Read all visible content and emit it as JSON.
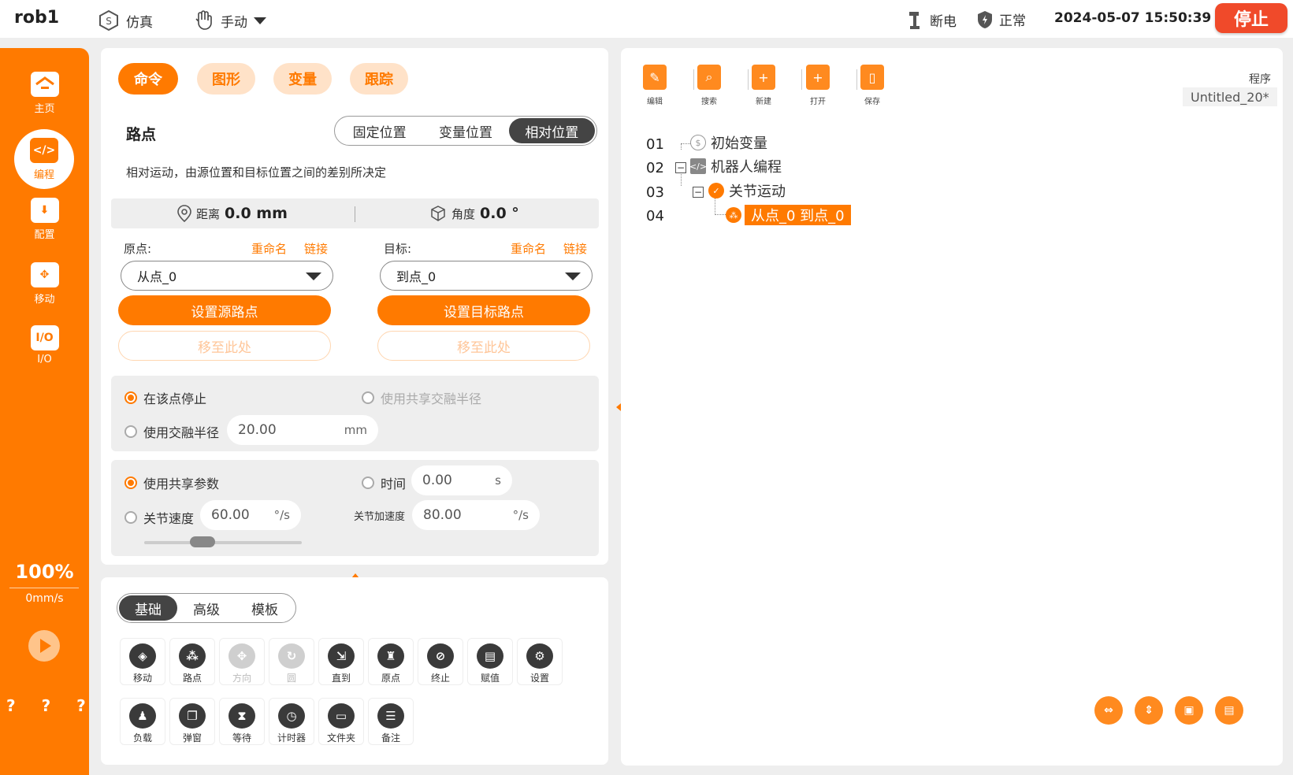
{
  "topbar": {
    "robot_name": "rob1",
    "sim_label": "仿真",
    "mode_label": "手动",
    "power_label": "断电",
    "safety_label": "正常",
    "datetime": "2024-05-07 15:50:39",
    "stop_label": "停止"
  },
  "sidebar": {
    "items": [
      {
        "label": "主页"
      },
      {
        "label": "编程"
      },
      {
        "label": "配置"
      },
      {
        "label": "移动"
      },
      {
        "label": "I/O",
        "icon_text": "I/O"
      }
    ],
    "speed_percent": "100%",
    "speed_value": "0mm/s",
    "help_marks": "? ? ? ?"
  },
  "tabs": [
    "命令",
    "图形",
    "变量",
    "跟踪"
  ],
  "waypoint": {
    "title": "路点",
    "modes": [
      "固定位置",
      "变量位置",
      "相对位置"
    ],
    "description": "相对运动，由源位置和目标位置之间的差别所决定",
    "distance_label": "距离",
    "distance_value": "0.0 mm",
    "angle_label": "角度",
    "angle_value": "0.0 °",
    "source_label": "原点:",
    "target_label": "目标:",
    "rename_label": "重命名",
    "link_label": "链接",
    "source_value": "从点_0",
    "target_value": "到点_0",
    "set_source_label": "设置源路点",
    "set_target_label": "设置目标路点",
    "move_here_label": "移至此处"
  },
  "blend": {
    "stop_label": "在该点停止",
    "shared_blend_label": "使用共享交融半径",
    "blend_label": "使用交融半径",
    "blend_value": "20.00",
    "blend_unit": "mm"
  },
  "params": {
    "shared_label": "使用共享参数",
    "time_label": "时间",
    "time_value": "0.00",
    "time_unit": "s",
    "joint_speed_label": "关节速度",
    "joint_speed_value": "60.00",
    "joint_speed_unit": "°/s",
    "joint_accel_label": "关节加速度",
    "joint_accel_value": "80.00",
    "joint_accel_unit": "°/s"
  },
  "library": {
    "tabs": [
      "基础",
      "高级",
      "模板"
    ],
    "row1": [
      {
        "label": "移动",
        "icon": "move-icon",
        "glyph": "◈"
      },
      {
        "label": "路点",
        "icon": "waypoint-icon",
        "glyph": "⁂"
      },
      {
        "label": "方向",
        "icon": "direction-icon",
        "glyph": "✥"
      },
      {
        "label": "圆",
        "icon": "circle-icon",
        "glyph": "↻"
      },
      {
        "label": "直到",
        "icon": "until-icon",
        "glyph": "⇲"
      },
      {
        "label": "原点",
        "icon": "home-icon",
        "glyph": "♜"
      },
      {
        "label": "终止",
        "icon": "halt-icon",
        "glyph": "⊘"
      },
      {
        "label": "赋值",
        "icon": "assign-icon",
        "glyph": "▤"
      },
      {
        "label": "设置",
        "icon": "settings-icon",
        "glyph": "⚙"
      }
    ],
    "row2": [
      {
        "label": "负载",
        "icon": "payload-icon",
        "glyph": "♟"
      },
      {
        "label": "弹窗",
        "icon": "popup-icon",
        "glyph": "❐"
      },
      {
        "label": "等待",
        "icon": "wait-icon",
        "glyph": "⧗"
      },
      {
        "label": "计时器",
        "icon": "timer-icon",
        "glyph": "◷"
      },
      {
        "label": "文件夹",
        "icon": "folder-icon",
        "glyph": "▭"
      },
      {
        "label": "备注",
        "icon": "comment-icon",
        "glyph": "☰"
      }
    ]
  },
  "program": {
    "toolbar": [
      "编辑",
      "搜索",
      "新建",
      "打开",
      "保存"
    ],
    "label": "程序",
    "name": "Untitled_20*",
    "lines": [
      {
        "num": "01",
        "text": "初始变量"
      },
      {
        "num": "02",
        "text": "机器人编程"
      },
      {
        "num": "03",
        "text": "关节运动"
      },
      {
        "num": "04",
        "text": "从点_0 到点_0"
      }
    ]
  },
  "colors": {
    "accent": "#ff7a00",
    "stop": "#f04a2a"
  }
}
